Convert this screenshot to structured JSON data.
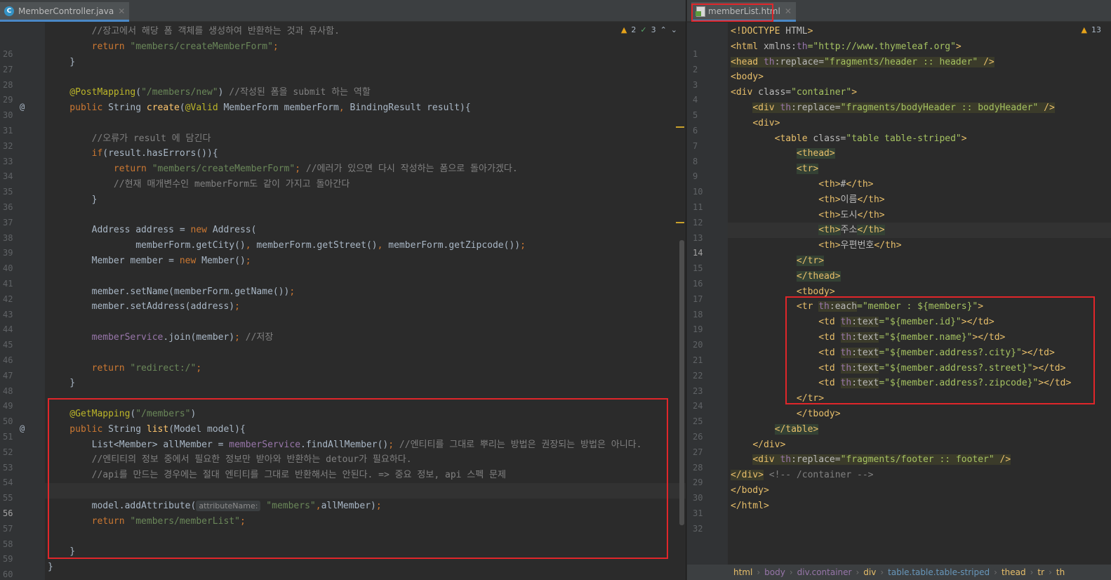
{
  "left_tab": {
    "label": "MemberController.java"
  },
  "right_tab": {
    "label": "memberList.html"
  },
  "left_inspections": {
    "warnings": "2",
    "weak_warnings": "3"
  },
  "right_inspections": {
    "warnings": "13"
  },
  "java_lines": [
    {
      "n": "26",
      "seg": [
        [
          "cm",
          "        //장고에서 해당 폼 객체를 생성하여 반환하는 것과 유사함."
        ]
      ]
    },
    {
      "n": "27",
      "seg": [
        [
          "kw",
          "        return "
        ],
        [
          "st",
          "\"members/createMemberForm\""
        ],
        [
          "kw",
          ";"
        ]
      ]
    },
    {
      "n": "28",
      "seg": [
        [
          "",
          "    }"
        ]
      ]
    },
    {
      "n": "29",
      "seg": []
    },
    {
      "n": "30",
      "seg": [
        [
          "an",
          "    @PostMapping"
        ],
        [
          "",
          "("
        ],
        [
          "st",
          "\"/members/new\""
        ],
        [
          "",
          ") "
        ],
        [
          "cm",
          "//작성된 폼을 submit 하는 역할"
        ]
      ]
    },
    {
      "n": "31",
      "seg": [
        [
          "kw",
          "    public "
        ],
        [
          "",
          "String "
        ],
        [
          "fn",
          "create"
        ],
        [
          "",
          "("
        ],
        [
          "an",
          "@Valid "
        ],
        [
          "",
          "MemberForm memberForm"
        ],
        [
          "kw",
          ", "
        ],
        [
          "",
          "BindingResult result){"
        ]
      ]
    },
    {
      "n": "32",
      "seg": []
    },
    {
      "n": "33",
      "seg": [
        [
          "cm",
          "        //오류가 result 에 담긴다"
        ]
      ]
    },
    {
      "n": "34",
      "seg": [
        [
          "kw",
          "        if"
        ],
        [
          "",
          "(result.hasErrors()){"
        ]
      ]
    },
    {
      "n": "35",
      "seg": [
        [
          "kw",
          "            return "
        ],
        [
          "st",
          "\"members/createMemberForm\""
        ],
        [
          "kw",
          "; "
        ],
        [
          "cm",
          "//에러가 있으면 다시 작성하는 폼으로 돌아가겠다."
        ]
      ]
    },
    {
      "n": "36",
      "seg": [
        [
          "cm",
          "            //현재 매개변수인 memberForm도 같이 가지고 돌아간다"
        ]
      ]
    },
    {
      "n": "37",
      "seg": [
        [
          "",
          "        }"
        ]
      ]
    },
    {
      "n": "38",
      "seg": []
    },
    {
      "n": "39",
      "seg": [
        [
          "",
          "        Address address = "
        ],
        [
          "kw",
          "new "
        ],
        [
          "",
          "Address("
        ]
      ]
    },
    {
      "n": "40",
      "seg": [
        [
          "",
          "                memberForm.getCity()"
        ],
        [
          "kw",
          ", "
        ],
        [
          "",
          "memberForm.getStreet()"
        ],
        [
          "kw",
          ", "
        ],
        [
          "",
          "memberForm.getZipcode())"
        ],
        [
          "kw",
          ";"
        ]
      ]
    },
    {
      "n": "41",
      "seg": [
        [
          "",
          "        Member member = "
        ],
        [
          "kw",
          "new "
        ],
        [
          "",
          "Member()"
        ],
        [
          "kw",
          ";"
        ]
      ]
    },
    {
      "n": "42",
      "seg": []
    },
    {
      "n": "43",
      "seg": [
        [
          "",
          "        member.setName(memberForm.getName())"
        ],
        [
          "kw",
          ";"
        ]
      ]
    },
    {
      "n": "44",
      "seg": [
        [
          "",
          "        member.setAddress(address)"
        ],
        [
          "kw",
          ";"
        ]
      ]
    },
    {
      "n": "45",
      "seg": []
    },
    {
      "n": "46",
      "seg": [
        [
          "fld",
          "        memberService"
        ],
        [
          "",
          ".join(member)"
        ],
        [
          "kw",
          "; "
        ],
        [
          "cm",
          "//저장"
        ]
      ]
    },
    {
      "n": "47",
      "seg": []
    },
    {
      "n": "48",
      "seg": [
        [
          "kw",
          "        return "
        ],
        [
          "st",
          "\"redirect:/\""
        ],
        [
          "kw",
          ";"
        ]
      ]
    },
    {
      "n": "49",
      "seg": [
        [
          "",
          "    }"
        ]
      ]
    },
    {
      "n": "50",
      "seg": []
    },
    {
      "n": "51",
      "seg": [
        [
          "an",
          "    @GetMapping"
        ],
        [
          "",
          "("
        ],
        [
          "st",
          "\"/members\""
        ],
        [
          "",
          ")"
        ]
      ]
    },
    {
      "n": "52",
      "seg": [
        [
          "kw",
          "    public "
        ],
        [
          "",
          "String "
        ],
        [
          "fn",
          "list"
        ],
        [
          "",
          "(Model model){"
        ]
      ]
    },
    {
      "n": "53",
      "seg": [
        [
          "",
          "        List<Member> allMember = "
        ],
        [
          "fld",
          "memberService"
        ],
        [
          "",
          ".findAllMember()"
        ],
        [
          "kw",
          "; "
        ],
        [
          "cm",
          "//엔티티를 그대로 뿌리는 방법은 권장되는 방법은 아니다."
        ]
      ]
    },
    {
      "n": "54",
      "seg": [
        [
          "cm",
          "        //엔티티의 정보 중에서 필요한 정보만 받아와 반환하는 detour가 필요하다."
        ]
      ]
    },
    {
      "n": "55",
      "seg": [
        [
          "cm",
          "        //api를 만드는 경우에는 절대 엔티티를 그대로 반환해서는 안된다. => 중요 정보, api 스펙 문제"
        ]
      ]
    },
    {
      "n": "56",
      "seg": []
    },
    {
      "n": "57",
      "seg": [
        [
          "",
          "        model.addAttribute("
        ],
        [
          "hint",
          "attributeName:"
        ],
        [
          "st",
          " \"members\""
        ],
        [
          "kw",
          ","
        ],
        [
          "",
          "allMember)"
        ],
        [
          "kw",
          ";"
        ]
      ]
    },
    {
      "n": "58",
      "seg": [
        [
          "kw",
          "        return "
        ],
        [
          "st",
          "\"members/memberList\""
        ],
        [
          "kw",
          ";"
        ]
      ]
    },
    {
      "n": "59",
      "seg": []
    },
    {
      "n": "60",
      "seg": [
        [
          "",
          "    }"
        ]
      ]
    },
    {
      "n": "61",
      "seg": [
        [
          "",
          "}"
        ]
      ]
    }
  ],
  "html_lines": [
    {
      "n": "1",
      "seg": [
        [
          "tg",
          "<!DOCTYPE "
        ],
        [
          "at",
          "HTML"
        ],
        [
          "tg",
          ">"
        ]
      ]
    },
    {
      "n": "2",
      "seg": [
        [
          "tg",
          "<html "
        ],
        [
          "at",
          "xmlns:"
        ],
        [
          "th",
          "th"
        ],
        [
          "av",
          "=\"http://www.thymeleaf.org\""
        ],
        [
          "tg",
          ">"
        ]
      ]
    },
    {
      "n": "3",
      "seg": [
        [
          "tg hl",
          "<head "
        ],
        [
          "th hl",
          "th"
        ],
        [
          "at hl",
          ":replace="
        ],
        [
          "av hl",
          "\"fragments/header :: header\" "
        ],
        [
          "tg hl",
          "/>"
        ]
      ]
    },
    {
      "n": "4",
      "seg": [
        [
          "tg",
          "<body>"
        ]
      ]
    },
    {
      "n": "5",
      "seg": [
        [
          "tg",
          "<div "
        ],
        [
          "at",
          "class="
        ],
        [
          "av",
          "\"container\""
        ],
        [
          "tg",
          ">"
        ]
      ]
    },
    {
      "n": "6",
      "seg": [
        [
          "",
          "    "
        ],
        [
          "tg hl",
          "<div "
        ],
        [
          "th hl",
          "th"
        ],
        [
          "at hl",
          ":replace="
        ],
        [
          "av hl",
          "\"fragments/bodyHeader :: bodyHeader\" "
        ],
        [
          "tg hl",
          "/>"
        ]
      ]
    },
    {
      "n": "7",
      "seg": [
        [
          "",
          "    "
        ],
        [
          "tg",
          "<div>"
        ]
      ]
    },
    {
      "n": "8",
      "seg": [
        [
          "",
          "        "
        ],
        [
          "tg",
          "<table "
        ],
        [
          "at",
          "class="
        ],
        [
          "av",
          "\"table table-striped\""
        ],
        [
          "tg",
          ">"
        ]
      ]
    },
    {
      "n": "9",
      "seg": [
        [
          "",
          "            "
        ],
        [
          "tg tghl",
          "<thead>"
        ]
      ]
    },
    {
      "n": "10",
      "seg": [
        [
          "",
          "            "
        ],
        [
          "tg tghl",
          "<tr>"
        ]
      ]
    },
    {
      "n": "11",
      "seg": [
        [
          "",
          "                "
        ],
        [
          "tg",
          "<th>"
        ],
        [
          "at",
          "#"
        ],
        [
          "tg",
          "</th>"
        ]
      ]
    },
    {
      "n": "12",
      "seg": [
        [
          "",
          "                "
        ],
        [
          "tg",
          "<th>"
        ],
        [
          "at",
          "이름"
        ],
        [
          "tg",
          "</th>"
        ]
      ]
    },
    {
      "n": "13",
      "seg": [
        [
          "",
          "                "
        ],
        [
          "tg",
          "<th>"
        ],
        [
          "at",
          "도시"
        ],
        [
          "tg",
          "</th>"
        ]
      ]
    },
    {
      "n": "14",
      "seg": [
        [
          "",
          "                "
        ],
        [
          "tg tghl",
          "<th>"
        ],
        [
          "at",
          "주소"
        ],
        [
          "tg tghl",
          "</th>"
        ]
      ]
    },
    {
      "n": "15",
      "seg": [
        [
          "",
          "                "
        ],
        [
          "tg",
          "<th>"
        ],
        [
          "at",
          "우편번호"
        ],
        [
          "tg",
          "</th>"
        ]
      ]
    },
    {
      "n": "16",
      "seg": [
        [
          "",
          "            "
        ],
        [
          "tg tghl",
          "</tr>"
        ]
      ]
    },
    {
      "n": "17",
      "seg": [
        [
          "",
          "            "
        ],
        [
          "tg tghl",
          "</thead>"
        ]
      ]
    },
    {
      "n": "18",
      "seg": [
        [
          "",
          "            "
        ],
        [
          "tg",
          "<tbody>"
        ]
      ]
    },
    {
      "n": "19",
      "seg": [
        [
          "",
          "            "
        ],
        [
          "tg",
          "<tr "
        ],
        [
          "th hl",
          "th"
        ],
        [
          "at hl",
          ":each"
        ],
        [
          "av",
          "=\"member : ${members}\""
        ],
        [
          "tg",
          ">"
        ]
      ]
    },
    {
      "n": "20",
      "seg": [
        [
          "",
          "                "
        ],
        [
          "tg",
          "<td "
        ],
        [
          "th hl",
          "th"
        ],
        [
          "at hl",
          ":text"
        ],
        [
          "av",
          "=\"${member.id}\""
        ],
        [
          "tg",
          "></td>"
        ]
      ]
    },
    {
      "n": "21",
      "seg": [
        [
          "",
          "                "
        ],
        [
          "tg",
          "<td "
        ],
        [
          "th hl",
          "th"
        ],
        [
          "at hl",
          ":text"
        ],
        [
          "av",
          "=\"${member.name}\""
        ],
        [
          "tg",
          "></td>"
        ]
      ]
    },
    {
      "n": "22",
      "seg": [
        [
          "",
          "                "
        ],
        [
          "tg",
          "<td "
        ],
        [
          "th hl",
          "th"
        ],
        [
          "at hl",
          ":text"
        ],
        [
          "av",
          "=\"${member.address?.city}\""
        ],
        [
          "tg",
          "></td>"
        ]
      ]
    },
    {
      "n": "23",
      "seg": [
        [
          "",
          "                "
        ],
        [
          "tg",
          "<td "
        ],
        [
          "th hl",
          "th"
        ],
        [
          "at hl",
          ":text"
        ],
        [
          "av",
          "=\"${member.address?.street}\""
        ],
        [
          "tg",
          "></td>"
        ]
      ]
    },
    {
      "n": "24",
      "seg": [
        [
          "",
          "                "
        ],
        [
          "tg",
          "<td "
        ],
        [
          "th hl",
          "th"
        ],
        [
          "at hl",
          ":text"
        ],
        [
          "av",
          "=\"${member.address?.zipcode}\""
        ],
        [
          "tg",
          "></td>"
        ]
      ]
    },
    {
      "n": "25",
      "seg": [
        [
          "",
          "            "
        ],
        [
          "tg",
          "</tr>"
        ]
      ]
    },
    {
      "n": "26",
      "seg": [
        [
          "",
          "            "
        ],
        [
          "tg",
          "</tbody>"
        ]
      ]
    },
    {
      "n": "27",
      "seg": [
        [
          "",
          "        "
        ],
        [
          "tg tghl",
          "</table>"
        ]
      ]
    },
    {
      "n": "28",
      "seg": [
        [
          "",
          "    "
        ],
        [
          "tg",
          "</div>"
        ]
      ]
    },
    {
      "n": "29",
      "seg": [
        [
          "",
          "    "
        ],
        [
          "tg hl",
          "<div "
        ],
        [
          "th hl",
          "th"
        ],
        [
          "at hl",
          ":replace="
        ],
        [
          "av hl",
          "\"fragments/footer :: footer\" "
        ],
        [
          "tg hl",
          "/>"
        ]
      ]
    },
    {
      "n": "30",
      "seg": [
        [
          "tg hl",
          "</div>"
        ],
        [
          "cm",
          " <!-- /container -->"
        ]
      ]
    },
    {
      "n": "31",
      "seg": [
        [
          "tg",
          "</body>"
        ]
      ]
    },
    {
      "n": "32",
      "seg": [
        [
          "tg",
          "</html>"
        ]
      ]
    }
  ],
  "breadcrumbs": [
    {
      "label": "html",
      "tone": "tag"
    },
    {
      "label": "body",
      "tone": "pink"
    },
    {
      "label": "div.container",
      "tone": "pink"
    },
    {
      "label": "div",
      "tone": "tag"
    },
    {
      "label": "table.table.table-striped",
      "tone": "blue"
    },
    {
      "label": "thead",
      "tone": "tag"
    },
    {
      "label": "tr",
      "tone": "tag"
    },
    {
      "label": "th",
      "tone": "tag"
    }
  ],
  "colors": {
    "highlight_box": "#e0262a",
    "background": "#2b2b2b",
    "gutter": "#313335"
  }
}
